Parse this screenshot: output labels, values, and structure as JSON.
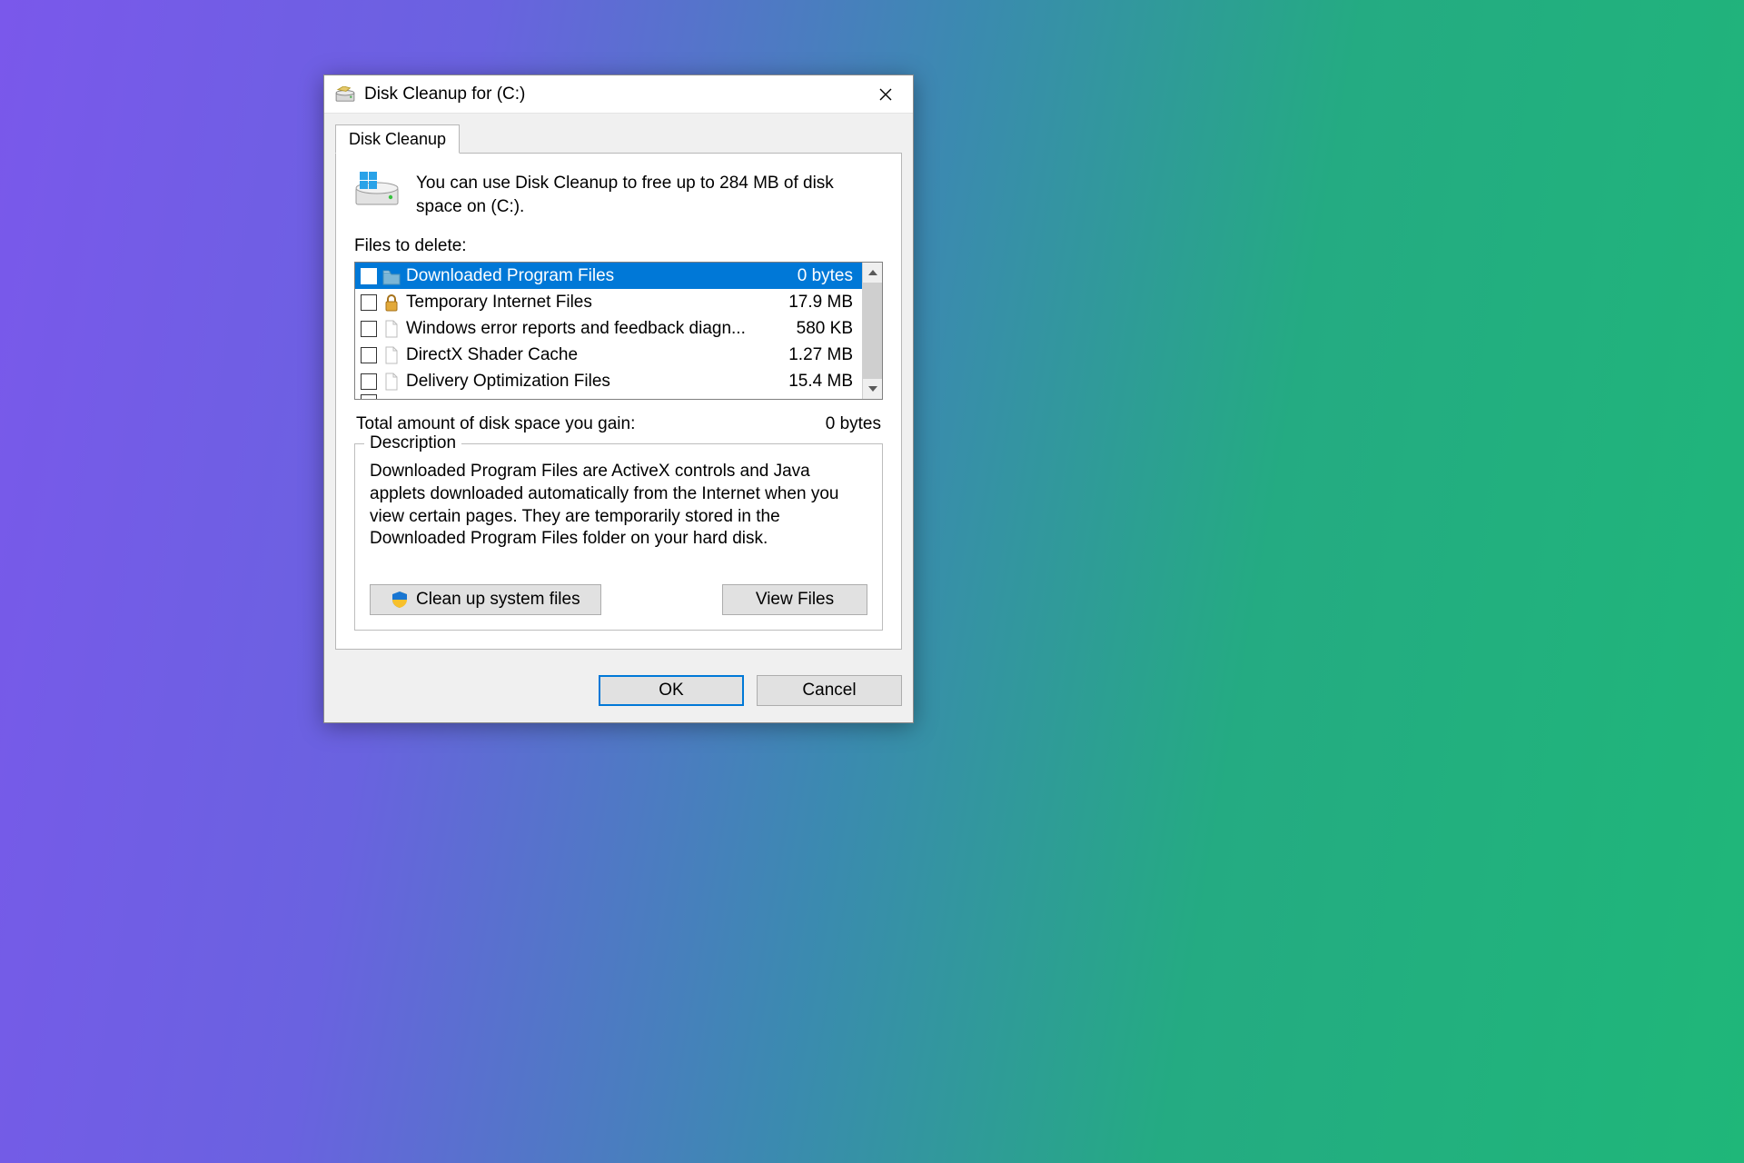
{
  "window": {
    "title": "Disk Cleanup for  (C:)"
  },
  "tab": {
    "label": "Disk Cleanup"
  },
  "intro": {
    "text": "You can use Disk Cleanup to free up to 284 MB of disk space on (C:)."
  },
  "files_label": "Files to delete:",
  "items": [
    {
      "name": "Downloaded Program Files",
      "size": "0 bytes",
      "icon": "folder",
      "selected": true
    },
    {
      "name": "Temporary Internet Files",
      "size": "17.9 MB",
      "icon": "lock",
      "selected": false
    },
    {
      "name": "Windows error reports and feedback diagn...",
      "size": "580 KB",
      "icon": "file",
      "selected": false
    },
    {
      "name": "DirectX Shader Cache",
      "size": "1.27 MB",
      "icon": "file",
      "selected": false
    },
    {
      "name": "Delivery Optimization Files",
      "size": "15.4 MB",
      "icon": "file",
      "selected": false
    }
  ],
  "total": {
    "label": "Total amount of disk space you gain:",
    "value": "0 bytes"
  },
  "description": {
    "title": "Description",
    "text": "Downloaded Program Files are ActiveX controls and Java applets downloaded automatically from the Internet when you view certain pages. They are temporarily stored in the Downloaded Program Files folder on your hard disk."
  },
  "buttons": {
    "cleanup_system": "Clean up system files",
    "view_files": "View Files",
    "ok": "OK",
    "cancel": "Cancel"
  }
}
